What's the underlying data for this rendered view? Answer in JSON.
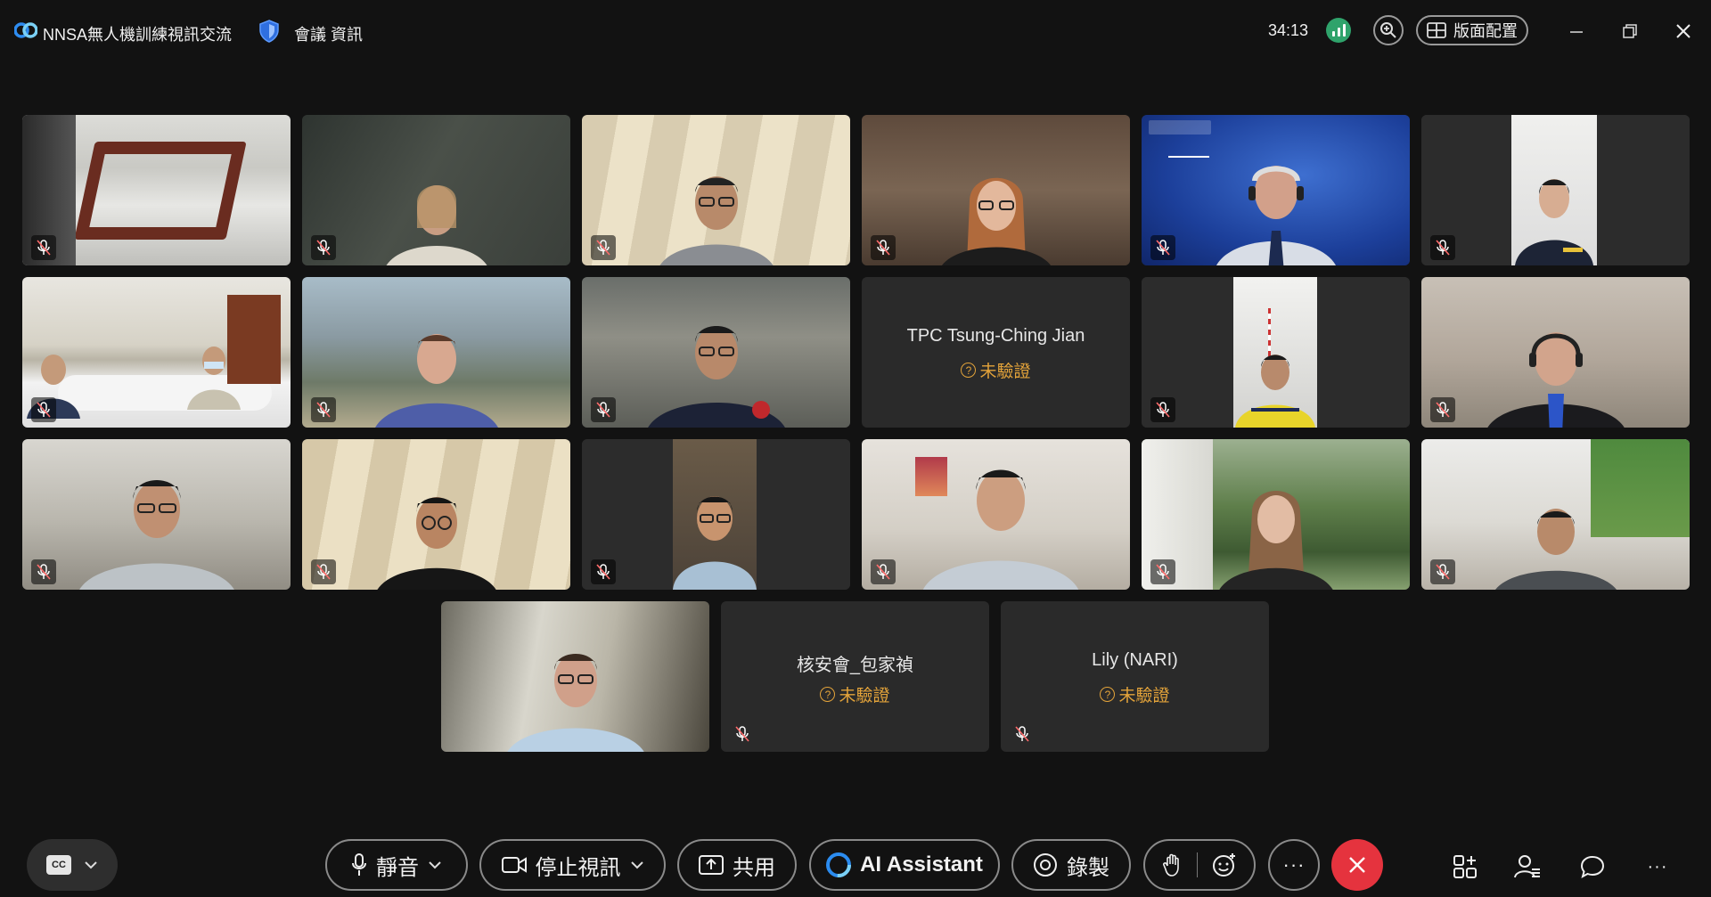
{
  "window": {
    "app_title": "NNSA無人機訓練視訊交流",
    "meeting_info_label": "會議 資訊",
    "timer": "34:13",
    "layout_label": "版面配置"
  },
  "participants": [
    {
      "id": "conference-room",
      "muted": true,
      "video": true
    },
    {
      "id": "woman-blonde",
      "muted": true,
      "video": true
    },
    {
      "id": "man-glasses-grey",
      "muted": true,
      "video": true
    },
    {
      "id": "woman-red-hair",
      "muted": true,
      "video": true
    },
    {
      "id": "man-ins-nnsa",
      "muted": true,
      "video": true
    },
    {
      "id": "woman-uniform",
      "muted": true,
      "video": true
    },
    {
      "id": "meeting-room-2",
      "muted": true,
      "video": true
    },
    {
      "id": "man-purple-shirt",
      "muted": true,
      "video": true
    },
    {
      "id": "police-officer",
      "muted": true,
      "video": true
    },
    {
      "id": "tpc",
      "name": "TPC  Tsung-Ching Jian",
      "status": "未驗證",
      "muted": false,
      "video": false
    },
    {
      "id": "yellow-vest",
      "muted": true,
      "video": true
    },
    {
      "id": "man-headset",
      "muted": true,
      "video": true
    },
    {
      "id": "man-grey-tee",
      "muted": true,
      "video": true
    },
    {
      "id": "young-man-glasses",
      "muted": true,
      "video": true
    },
    {
      "id": "man-narrow",
      "muted": true,
      "video": true
    },
    {
      "id": "man-office",
      "muted": true,
      "video": true
    },
    {
      "id": "woman-forest",
      "muted": true,
      "video": true
    },
    {
      "id": "man-office-green",
      "muted": true,
      "video": true
    },
    {
      "id": "man-blue-shirt",
      "muted": false,
      "video": true
    },
    {
      "id": "bao",
      "name": "核安會_包家禎",
      "status": "未驗證",
      "muted": true,
      "video": false
    },
    {
      "id": "lily",
      "name": "Lily (NARI)",
      "status": "未驗證",
      "muted": true,
      "video": false
    }
  ],
  "toolbar": {
    "mute_label": "靜音",
    "stop_video_label": "停止視訊",
    "share_label": "共用",
    "ai_label": "AI Assistant",
    "record_label": "錄製",
    "cc_label": "CC"
  },
  "colors": {
    "background": "#121212",
    "unverified": "#e3a33a",
    "end_call": "#e5333e",
    "stats_green": "#2fa36b"
  },
  "icons": {
    "app_logo": "webex-logo-icon",
    "security": "shield-icon",
    "stats": "signal-stats-icon",
    "zoom": "zoom-in-icon",
    "layout": "grid-layout-icon",
    "minimize": "minimize-icon",
    "restore": "restore-icon",
    "close": "close-icon",
    "mic_muted": "mic-off-icon",
    "apps": "apps-icon",
    "participants": "participants-icon",
    "chat": "chat-icon",
    "more": "more-icon"
  }
}
